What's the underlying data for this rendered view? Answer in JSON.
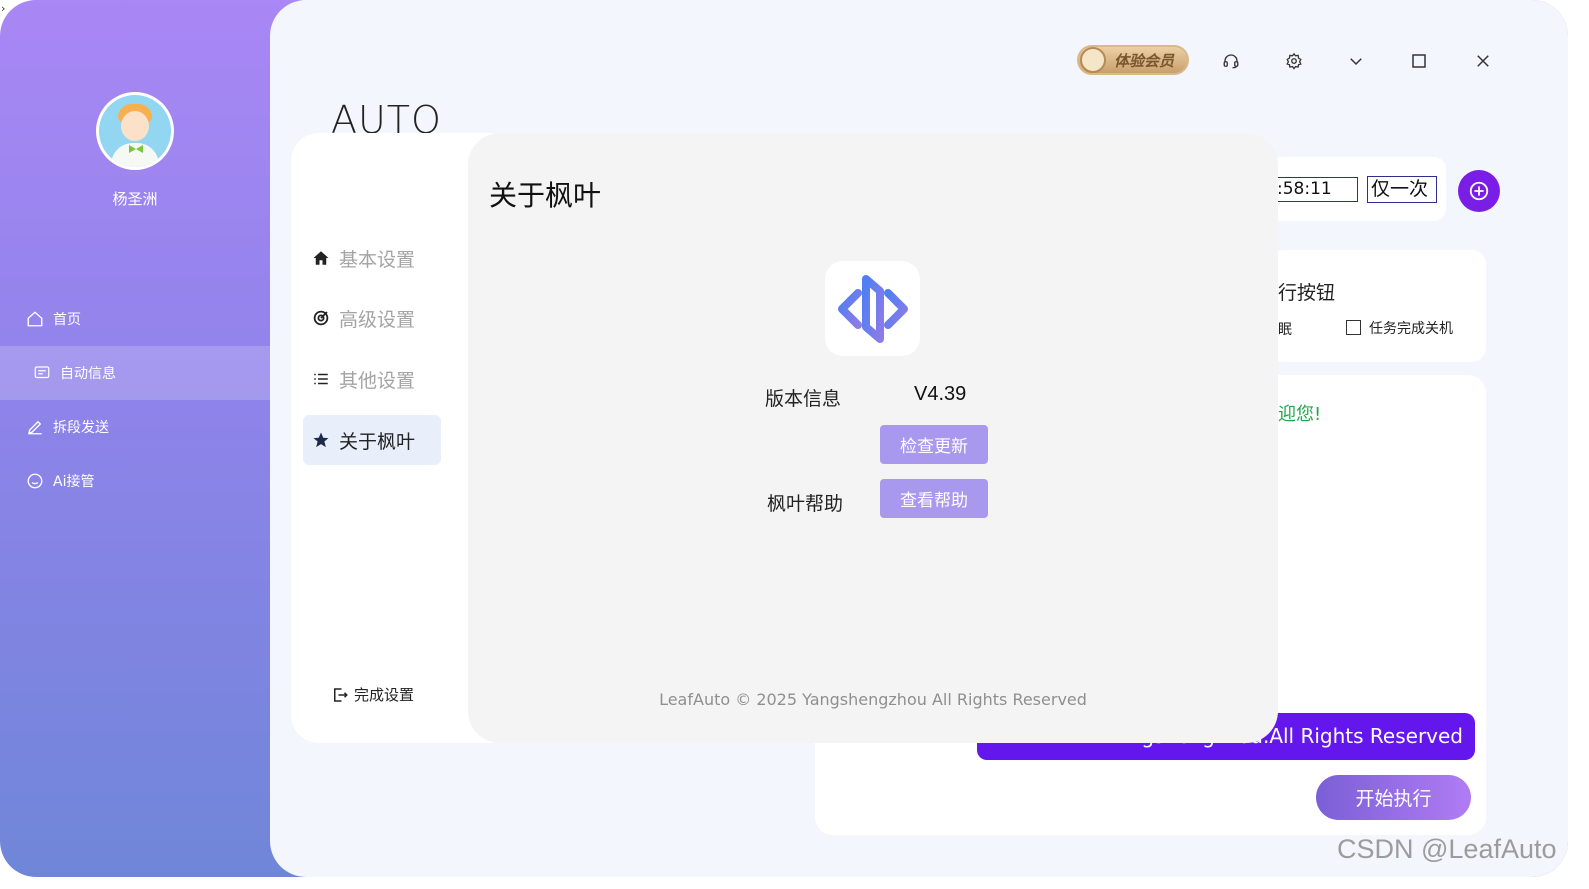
{
  "stray_char": "›",
  "sidebar": {
    "username": "杨圣洲",
    "items": [
      {
        "label": "首页",
        "icon": "home-icon"
      },
      {
        "label": "自动信息",
        "icon": "message-icon",
        "active": true
      },
      {
        "label": "拆段发送",
        "icon": "pencil-icon"
      },
      {
        "label": "Ai接管",
        "icon": "smiley-icon"
      }
    ]
  },
  "titlebar": {
    "vip_label": "体验会员",
    "icons": [
      "headset-icon",
      "gear-icon",
      "chevron-down-icon",
      "maximize-icon",
      "close-icon"
    ]
  },
  "main": {
    "app_title": "AUTO",
    "time_value": ":58:11",
    "frequency": "仅一次",
    "run_card_title": "行按钮",
    "partial_option": "眠",
    "shutdown_label": "任务完成关机",
    "welcome_text": "迎您!",
    "message_text": "gshengzhou.All Rights Reserved",
    "start_button": "开始执行",
    "watermark": "CSDN @LeafAuto"
  },
  "settings": {
    "nav": [
      {
        "label": "基本设置",
        "icon": "home-icon"
      },
      {
        "label": "高级设置",
        "icon": "target-icon"
      },
      {
        "label": "其他设置",
        "icon": "list-icon"
      },
      {
        "label": "关于枫叶",
        "icon": "star-icon",
        "active": true
      }
    ],
    "done_label": "完成设置",
    "panel_title": "关于枫叶",
    "version_label": "版本信息",
    "version_value": "V4.39",
    "check_update": "检查更新",
    "help_label": "枫叶帮助",
    "view_help": "查看帮助",
    "footer": "LeafAuto © 2025 Yangshengzhou All Rights Reserved"
  },
  "colors": {
    "accent_purple": "#7a1ee6",
    "button_purple": "#a999ee",
    "welcome_green": "#1ea84a"
  }
}
